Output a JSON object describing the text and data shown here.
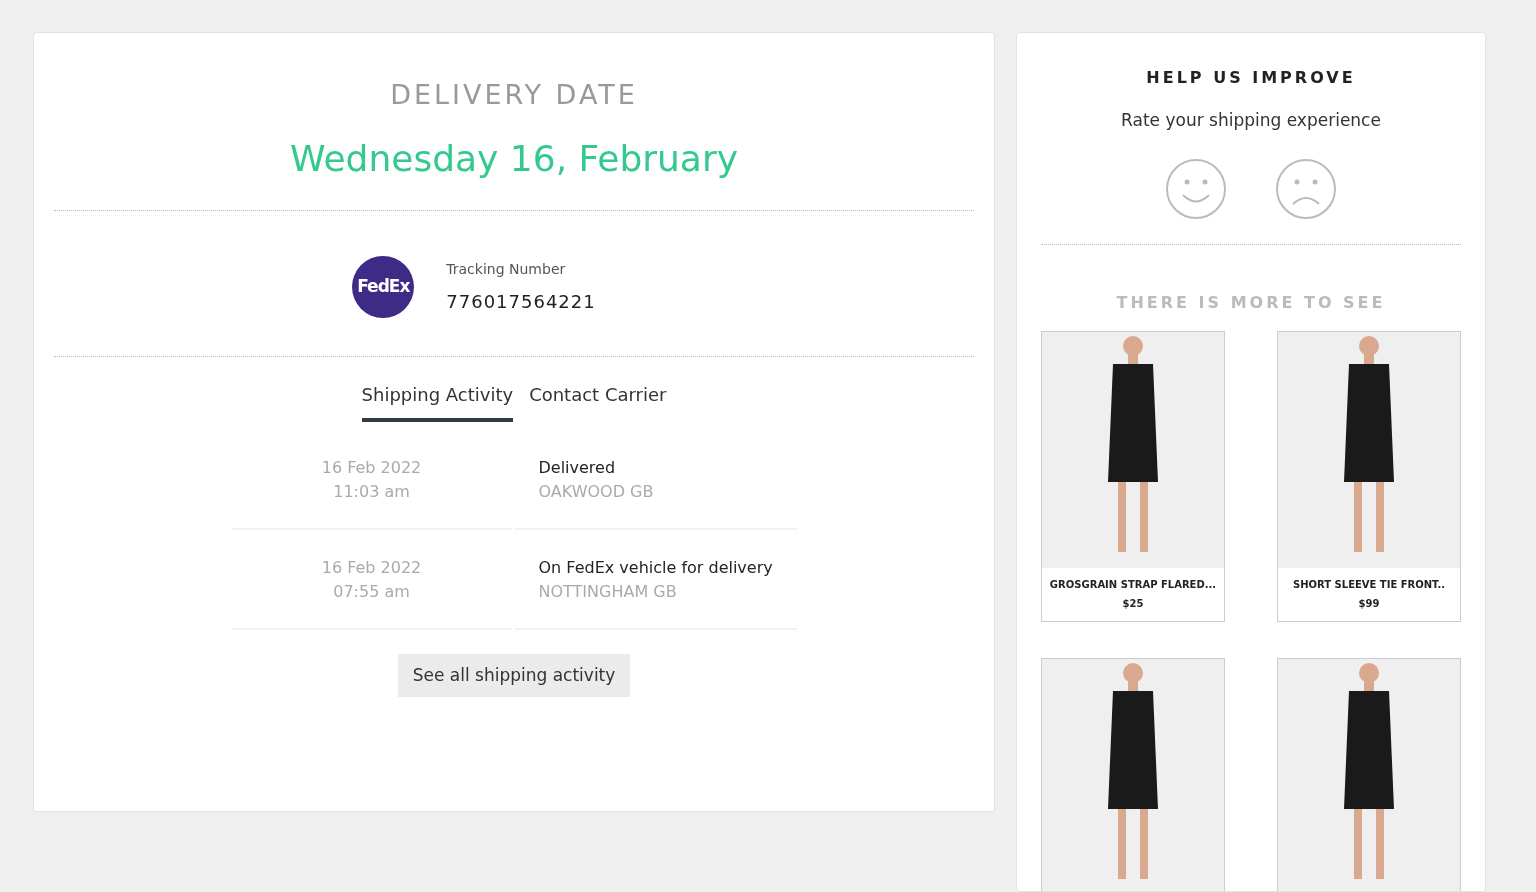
{
  "delivery": {
    "heading": "DELIVERY DATE",
    "date": "Wednesday 16, February"
  },
  "carrier": {
    "logo_text": "FedEx",
    "tracking_label": "Tracking Number",
    "tracking_number": "776017564221"
  },
  "tabs": [
    {
      "label": "Shipping Activity",
      "selected": true
    },
    {
      "label": "Contact Carrier",
      "selected": false
    }
  ],
  "activity": [
    {
      "date": "16 Feb 2022",
      "time": "11:03 am",
      "status": "Delivered",
      "location": "OAKWOOD GB"
    },
    {
      "date": "16 Feb 2022",
      "time": "07:55 am",
      "status": "On FedEx vehicle for delivery",
      "location": "NOTTINGHAM GB"
    }
  ],
  "see_all_button": "See all shipping activity",
  "feedback": {
    "heading": "HELP US IMPROVE",
    "prompt": "Rate your shipping experience"
  },
  "more": {
    "heading": "THERE IS MORE TO SEE",
    "products": [
      {
        "kind": "full",
        "name": "GROSGRAIN STRAP FLARED...",
        "price": "$25"
      },
      {
        "kind": "full",
        "name": "SHORT SLEEVE TIE FRONT..",
        "price": "$99"
      },
      {
        "kind": "cut"
      },
      {
        "kind": "cut"
      }
    ]
  }
}
